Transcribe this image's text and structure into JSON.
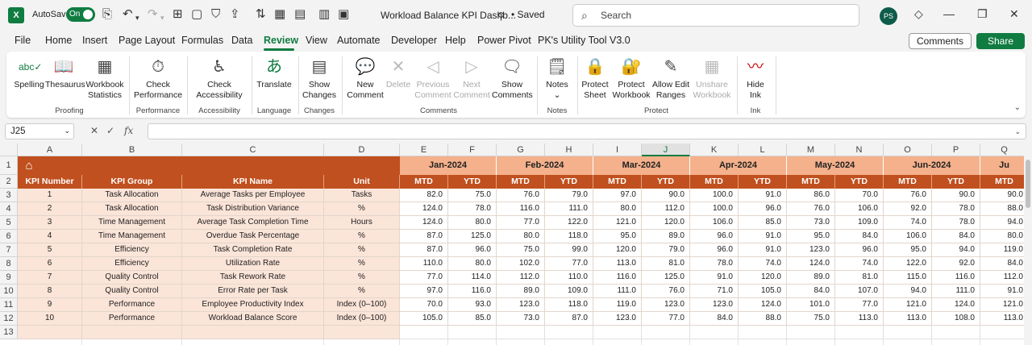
{
  "titlebar": {
    "app_logo": "X",
    "autosave_label": "AutoSave",
    "autosave_state": "On",
    "doc_title": "Workload Balance KPI Dashb...",
    "saved_status": "• Saved",
    "search_placeholder": "Search",
    "user_initials": "PS"
  },
  "menu": {
    "items": [
      "File",
      "Home",
      "Insert",
      "Page Layout",
      "Formulas",
      "Data",
      "Review",
      "View",
      "Automate",
      "Developer",
      "Help",
      "Power Pivot",
      "PK's Utility Tool V3.0"
    ],
    "active": "Review",
    "comments_label": "Comments",
    "share_label": "Share"
  },
  "ribbon": {
    "buttons": [
      {
        "label": "Spelling",
        "icon": "spelling-icon"
      },
      {
        "label": "Thesaurus",
        "icon": "thesaurus-icon"
      },
      {
        "label": "Workbook Statistics",
        "icon": "statistics-icon"
      },
      {
        "label": "Check Performance",
        "icon": "performance-icon"
      },
      {
        "label": "Check Accessibility",
        "icon": "accessibility-icon"
      },
      {
        "label": "Translate",
        "icon": "translate-icon"
      },
      {
        "label": "Show Changes",
        "icon": "changes-icon"
      },
      {
        "label": "New Comment",
        "icon": "new-comment-icon"
      },
      {
        "label": "Delete",
        "icon": "delete-comment-icon",
        "disabled": true
      },
      {
        "label": "Previous Comment",
        "icon": "previous-comment-icon",
        "disabled": true
      },
      {
        "label": "Next Comment",
        "icon": "next-comment-icon",
        "disabled": true
      },
      {
        "label": "Show Comments",
        "icon": "show-comments-icon"
      },
      {
        "label": "Notes",
        "icon": "notes-icon"
      },
      {
        "label": "Protect Sheet",
        "icon": "protect-sheet-icon"
      },
      {
        "label": "Protect Workbook",
        "icon": "protect-workbook-icon"
      },
      {
        "label": "Allow Edit Ranges",
        "icon": "allow-edit-icon"
      },
      {
        "label": "Unshare Workbook",
        "icon": "unshare-icon",
        "disabled": true
      },
      {
        "label": "Hide Ink",
        "icon": "ink-icon"
      }
    ],
    "groups": [
      "Proofing",
      "Performance",
      "Accessibility",
      "Language",
      "Changes",
      "Comments",
      "Notes",
      "Protect",
      "Ink"
    ]
  },
  "formula_bar": {
    "name_box": "J25",
    "fx": "fx",
    "formula": ""
  },
  "sheet": {
    "columns": [
      "A",
      "B",
      "C",
      "D",
      "E",
      "F",
      "G",
      "H",
      "I",
      "J",
      "K",
      "L",
      "M",
      "N",
      "O",
      "P",
      "Q"
    ],
    "selected_column": "J",
    "rows": [
      "1",
      "2",
      "3",
      "4",
      "5",
      "6",
      "7",
      "8",
      "9",
      "10",
      "11",
      "12",
      "13"
    ],
    "headers": [
      "KPI Number",
      "KPI Group",
      "KPI Name",
      "Unit"
    ],
    "months": [
      "Jan-2024",
      "Feb-2024",
      "Mar-2024",
      "Apr-2024",
      "May-2024",
      "Jun-2024",
      "Ju"
    ],
    "subheaders": [
      "MTD",
      "YTD",
      "MTD",
      "YTD",
      "MTD",
      "YTD",
      "MTD",
      "YTD",
      "MTD",
      "YTD",
      "MTD",
      "YTD",
      "MTD"
    ],
    "data": [
      [
        "1",
        "Task Allocation",
        "Average Tasks per Employee",
        "Tasks",
        "82.0",
        "75.0",
        "76.0",
        "79.0",
        "97.0",
        "90.0",
        "100.0",
        "91.0",
        "86.0",
        "70.0",
        "76.0",
        "90.0",
        "90.0"
      ],
      [
        "2",
        "Task Allocation",
        "Task Distribution Variance",
        "%",
        "124.0",
        "78.0",
        "116.0",
        "111.0",
        "80.0",
        "112.0",
        "100.0",
        "96.0",
        "76.0",
        "106.0",
        "92.0",
        "78.0",
        "88.0"
      ],
      [
        "3",
        "Time Management",
        "Average Task Completion Time",
        "Hours",
        "124.0",
        "80.0",
        "77.0",
        "122.0",
        "121.0",
        "120.0",
        "106.0",
        "85.0",
        "73.0",
        "109.0",
        "74.0",
        "78.0",
        "94.0"
      ],
      [
        "4",
        "Time Management",
        "Overdue Task Percentage",
        "%",
        "87.0",
        "125.0",
        "80.0",
        "118.0",
        "95.0",
        "89.0",
        "96.0",
        "91.0",
        "95.0",
        "84.0",
        "106.0",
        "84.0",
        "80.0"
      ],
      [
        "5",
        "Efficiency",
        "Task Completion Rate",
        "%",
        "87.0",
        "96.0",
        "75.0",
        "99.0",
        "120.0",
        "79.0",
        "96.0",
        "91.0",
        "123.0",
        "96.0",
        "95.0",
        "94.0",
        "119.0"
      ],
      [
        "6",
        "Efficiency",
        "Utilization Rate",
        "%",
        "110.0",
        "80.0",
        "102.0",
        "77.0",
        "113.0",
        "81.0",
        "78.0",
        "74.0",
        "124.0",
        "74.0",
        "122.0",
        "92.0",
        "84.0"
      ],
      [
        "7",
        "Quality Control",
        "Task Rework Rate",
        "%",
        "77.0",
        "114.0",
        "112.0",
        "110.0",
        "116.0",
        "125.0",
        "91.0",
        "120.0",
        "89.0",
        "81.0",
        "115.0",
        "116.0",
        "112.0"
      ],
      [
        "8",
        "Quality Control",
        "Error Rate per Task",
        "%",
        "97.0",
        "116.0",
        "89.0",
        "109.0",
        "111.0",
        "76.0",
        "71.0",
        "105.0",
        "84.0",
        "107.0",
        "94.0",
        "111.0",
        "91.0"
      ],
      [
        "9",
        "Performance",
        "Employee Productivity Index",
        "Index (0–100)",
        "70.0",
        "93.0",
        "123.0",
        "118.0",
        "119.0",
        "123.0",
        "123.0",
        "124.0",
        "101.0",
        "77.0",
        "121.0",
        "124.0",
        "121.0"
      ],
      [
        "10",
        "Performance",
        "Workload Balance Score",
        "Index (0–100)",
        "105.0",
        "85.0",
        "73.0",
        "87.0",
        "123.0",
        "77.0",
        "84.0",
        "88.0",
        "75.0",
        "113.0",
        "113.0",
        "108.0",
        "113.0"
      ]
    ]
  }
}
